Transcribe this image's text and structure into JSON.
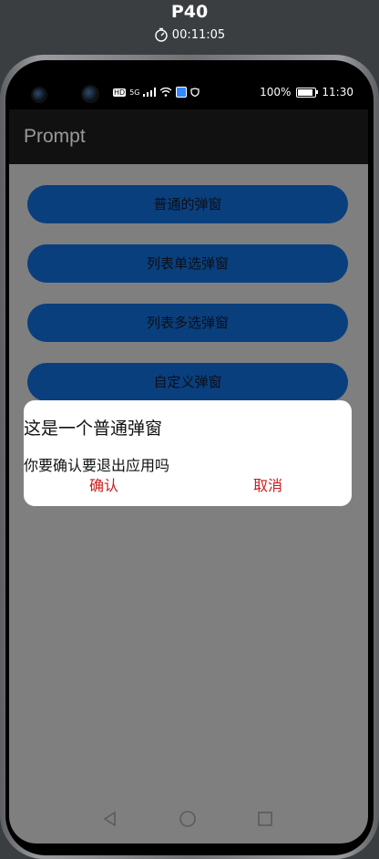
{
  "device": {
    "name": "P40",
    "timer": "00:11:05"
  },
  "status_bar": {
    "left_tags": [
      "HD",
      "5G"
    ],
    "battery": "100%",
    "time": "11:30"
  },
  "app": {
    "title": "Prompt"
  },
  "buttons": [
    {
      "label": "普通的弹窗"
    },
    {
      "label": "列表单选弹窗"
    },
    {
      "label": "列表多选弹窗"
    },
    {
      "label": "自定义弹窗"
    }
  ],
  "dialog": {
    "title": "这是一个普通弹窗",
    "message": "你要确认要退出应用吗",
    "confirm": "确认",
    "cancel": "取消"
  },
  "colors": {
    "primary_button": "#0a3f7d",
    "dialog_action": "#cc1b1b",
    "app_bar": "#111111",
    "screen_dim": "#7f7f7f"
  },
  "icons": [
    "stopwatch-icon",
    "signal-icon",
    "wifi-icon",
    "battery-icon",
    "back-icon",
    "home-icon",
    "recents-icon"
  ]
}
